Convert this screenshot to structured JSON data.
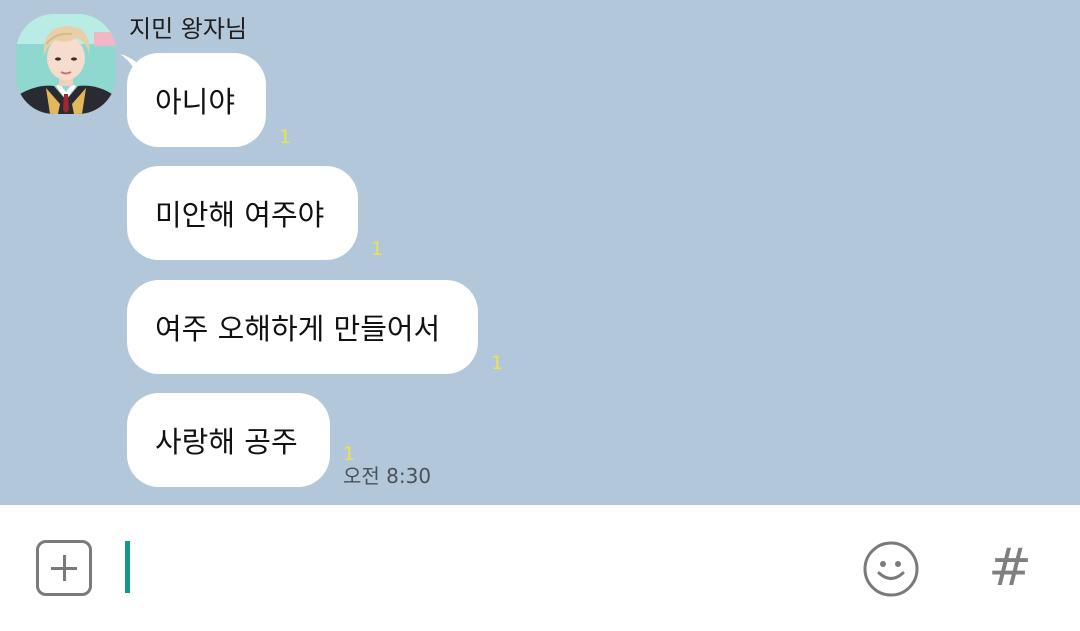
{
  "chat": {
    "sender_name": "지민 왕자님",
    "messages": [
      {
        "text": "아니야",
        "unread": "1"
      },
      {
        "text": "미안해 여주야",
        "unread": "1"
      },
      {
        "text": "여주 오해하게 만들어서",
        "unread": "1"
      },
      {
        "text": "사랑해 공주",
        "unread": "1",
        "time": "오전 8:30"
      }
    ]
  },
  "input_bar": {
    "attach_icon": "plus-square-icon",
    "emoji_icon": "smiley-icon",
    "hashtag_label": "#"
  },
  "colors": {
    "chat_background": "#b2c7d9",
    "bubble": "#ffffff",
    "unread_count": "#ece24f",
    "cursor": "#169689",
    "icon_gray": "#7a7a7a"
  }
}
